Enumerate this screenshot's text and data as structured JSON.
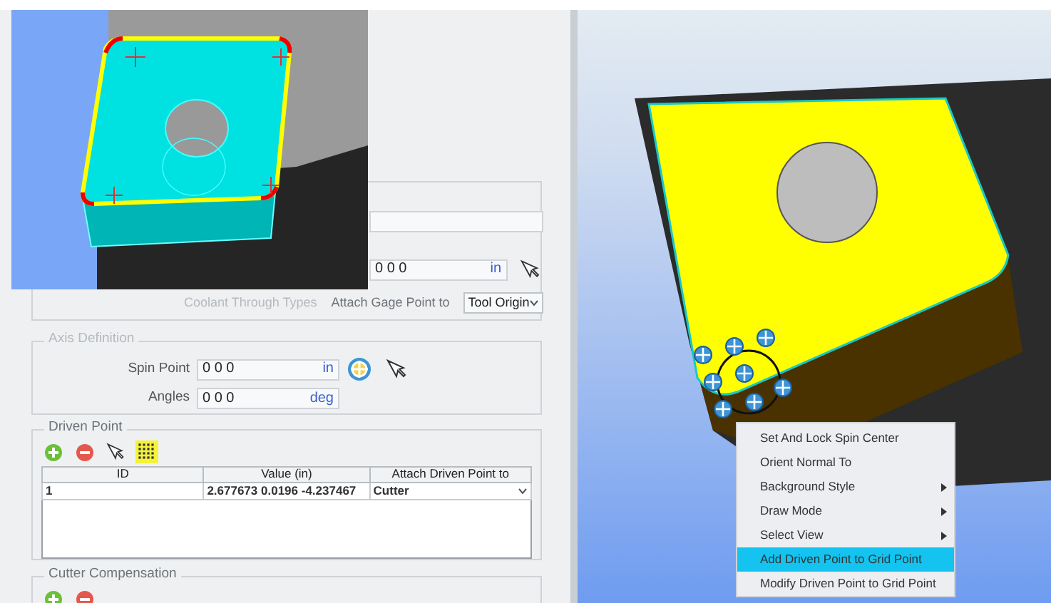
{
  "gage_point": {
    "value": "0 0 0",
    "unit": "in",
    "coolant_label": "Coolant Through Types",
    "attach_label": "Attach Gage Point to",
    "attach_value": "Tool Origin"
  },
  "axis_definition": {
    "title": "Axis Definition",
    "rows": [
      {
        "label": "Spin Point",
        "value": "0 0 0",
        "unit": "in",
        "kind": "point"
      },
      {
        "label": "Angles",
        "value": "0 0 0",
        "unit": "deg",
        "kind": "angles"
      }
    ]
  },
  "driven_point": {
    "title": "Driven Point",
    "toolbar": [
      {
        "kind": "add",
        "selected": false
      },
      {
        "kind": "remove",
        "selected": false
      },
      {
        "kind": "pick",
        "selected": false
      },
      {
        "kind": "grid",
        "selected": true
      }
    ],
    "table": {
      "columns": [
        "ID",
        "Value (in)",
        "Attach Driven Point to"
      ],
      "rows": [
        {
          "id": "1",
          "value": "2.677673 0.0196 -4.237467",
          "attach": "Cutter"
        }
      ]
    }
  },
  "cutter_compensation": {
    "title": "Cutter Compensation",
    "toolbar": [
      {
        "kind": "add",
        "selected": false
      },
      {
        "kind": "remove",
        "selected": false
      }
    ]
  },
  "context_menu": {
    "items": [
      {
        "label": "Set And Lock Spin Center",
        "submenu": false,
        "selected": false
      },
      {
        "label": "Orient Normal To",
        "submenu": false,
        "selected": false
      },
      {
        "label": "Background Style",
        "submenu": true,
        "selected": false
      },
      {
        "label": "Draw Mode",
        "submenu": true,
        "selected": false
      },
      {
        "label": "Select View",
        "submenu": true,
        "selected": false
      },
      {
        "label": "Add Driven Point to Grid Point",
        "submenu": false,
        "selected": true
      },
      {
        "label": "Modify Driven Point to Grid Point",
        "submenu": false,
        "selected": false
      }
    ]
  }
}
